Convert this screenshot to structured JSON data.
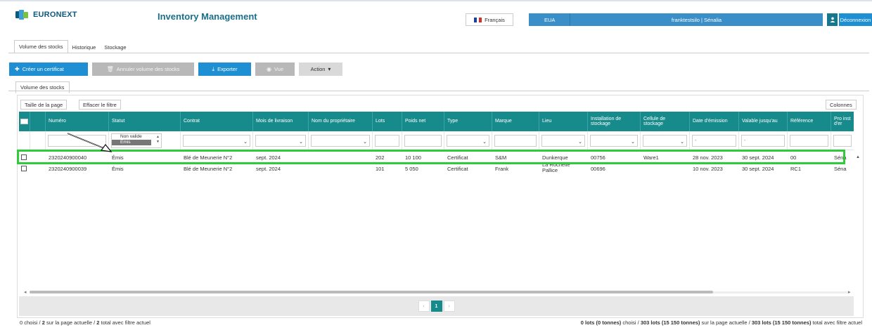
{
  "header": {
    "logo_text": "EURONEXT",
    "app_title": "Inventory Management",
    "language": "Français",
    "user_code": "EUA",
    "user_name": "franktestsilo | Sénalia",
    "logout": "Déconnexion",
    "brand_color": "#0e5a7e",
    "accent_color": "#1e8fd2"
  },
  "top_tabs": [
    {
      "label": "Volume des stocks",
      "active": true
    },
    {
      "label": "Historique",
      "active": false
    },
    {
      "label": "Stockage",
      "active": false
    }
  ],
  "toolbar": {
    "create": "Créer un certificat",
    "cancel": "Annuler volume des stocks",
    "export": "Exporter",
    "view": "Vue",
    "action": "Action"
  },
  "sub_tab": "Volume des stocks",
  "grid": {
    "page_size_btn": "Taille de la page",
    "clear_filter_btn": "Effacer le filtre",
    "columns_btn": "Colonnes",
    "header_color": "#178b8b",
    "columns": [
      "Numéro",
      "Statut",
      "Contrat",
      "Mois de livraison",
      "Nom du propriétaire",
      "Lots",
      "Poids net",
      "Type",
      "Marque",
      "Lieu",
      "Installation de stockage",
      "Cellule de stockage",
      "Date d'émission",
      "Valable jusqu'au",
      "Référence",
      "Pro inst d'er"
    ],
    "status_filter_options": [
      "Non valide",
      "Émis"
    ],
    "status_filter_selected": "Émis",
    "date_filter_placeholder": "-",
    "rows": [
      {
        "numero": "2320240900040",
        "statut": "Émis",
        "contrat": "Blé de Meunerie N°2",
        "mois": "sept. 2024",
        "proprietaire": "",
        "lots": "202",
        "poids": "10 100",
        "type": "Certificat",
        "marque": "S&M",
        "lieu": "Dunkerque",
        "installation": "00756",
        "cellule": "Ware1",
        "emission": "28 nov. 2023",
        "valable": "30 sept. 2024",
        "reference": "00",
        "pro": "Séna"
      },
      {
        "numero": "2320240900039",
        "statut": "Émis",
        "contrat": "Blé de Meunerie N°2",
        "mois": "sept. 2024",
        "proprietaire": "",
        "lots": "101",
        "poids": "5 050",
        "type": "Certificat",
        "marque": "Frank",
        "lieu": "La Rochelle Pallice",
        "installation": "00696",
        "cellule": "",
        "emission": "10 nov. 2023",
        "valable": "30 sept. 2024",
        "reference": "RC1",
        "pro": "Séna"
      }
    ],
    "highlight_color": "#2fcb3a"
  },
  "pager": {
    "prev": "‹",
    "current": "1",
    "next": "›"
  },
  "footer": {
    "left_chosen": "0",
    "left_chosen_text": " choisi / ",
    "left_page": "2",
    "left_page_text": " sur la page actuelle / ",
    "left_total": "2",
    "left_total_text": " total avec filtre actuel",
    "right_chosen": "0 lots (0 tonnes)",
    "right_chosen_text": " choisi / ",
    "right_page": "303 lots (15 150 tonnes)",
    "right_page_text": " sur la page actuelle / ",
    "right_total": "303 lots (15 150 tonnes)",
    "right_total_text": " total avec filtre actuel"
  }
}
